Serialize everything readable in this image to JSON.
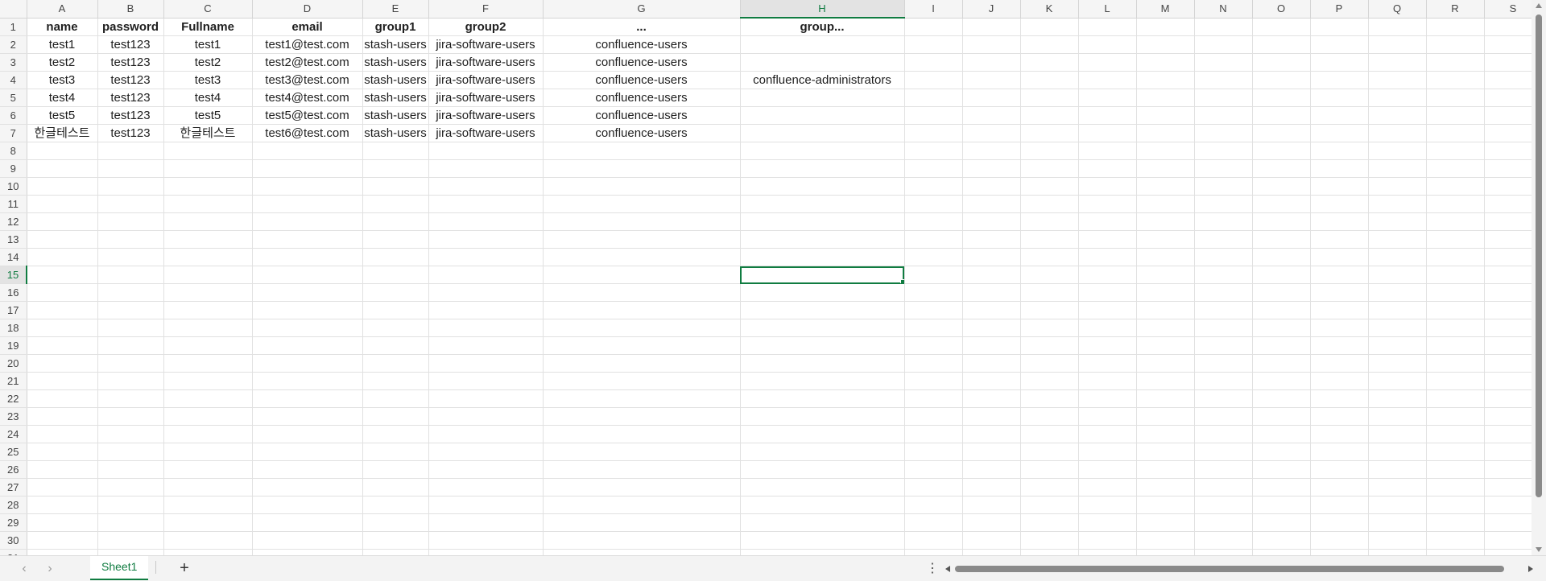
{
  "spreadsheet": {
    "columns": [
      "A",
      "B",
      "C",
      "D",
      "E",
      "F",
      "G",
      "H",
      "I",
      "J",
      "K",
      "L",
      "M",
      "N",
      "O",
      "P",
      "Q",
      "R",
      "S"
    ],
    "selected_column": "H",
    "selected_row": 15,
    "row_count": 31,
    "rows": [
      [
        "name",
        "password",
        "Fullname",
        "email",
        "group1",
        "group2",
        "...",
        "group..."
      ],
      [
        "test1",
        "test123",
        "test1",
        "test1@test.com",
        "stash-users",
        "jira-software-users",
        "confluence-users",
        ""
      ],
      [
        "test2",
        "test123",
        "test2",
        "test2@test.com",
        "stash-users",
        "jira-software-users",
        "confluence-users",
        ""
      ],
      [
        "test3",
        "test123",
        "test3",
        "test3@test.com",
        "stash-users",
        "jira-software-users",
        "confluence-users",
        "confluence-administrators"
      ],
      [
        "test4",
        "test123",
        "test4",
        "test4@test.com",
        "stash-users",
        "jira-software-users",
        "confluence-users",
        ""
      ],
      [
        "test5",
        "test123",
        "test5",
        "test5@test.com",
        "stash-users",
        "jira-software-users",
        "confluence-users",
        ""
      ],
      [
        "한글테스트",
        "test123",
        "한글테스트",
        "test6@test.com",
        "stash-users",
        "jira-software-users",
        "confluence-users",
        ""
      ]
    ]
  },
  "sheetbar": {
    "prev_icon": "‹",
    "next_icon": "›",
    "active_sheet": "Sheet1",
    "add_icon": "+",
    "more_icon": "⋮"
  },
  "colors": {
    "accent": "#107c41",
    "grid_line": "#e1e1e1",
    "header_bg": "#f5f5f5"
  }
}
